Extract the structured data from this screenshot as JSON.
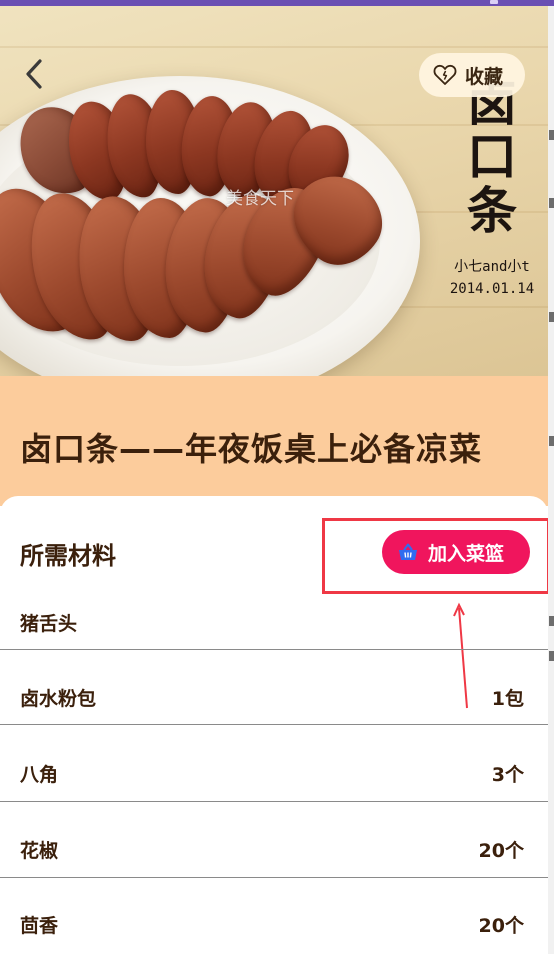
{
  "hero": {
    "callig_text": "卤口条",
    "credit_line1": "小七and小t",
    "credit_line2": "2014.01.14",
    "watermark": "美食天下"
  },
  "toolbar": {
    "back_icon": "chevron-left-icon",
    "favorite_icon": "heart-outline-icon",
    "favorite_label": "收藏"
  },
  "recipe": {
    "title": "卤口条——年夜饭桌上必备凉菜"
  },
  "ingredients": {
    "heading": "所需材料",
    "basket_icon": "basket-icon",
    "add_to_basket_label": "加入菜篮",
    "items": [
      {
        "name": "猪舌头",
        "amount": ""
      },
      {
        "name": "卤水粉包",
        "amount": "1包"
      },
      {
        "name": "八角",
        "amount": "3个"
      },
      {
        "name": "花椒",
        "amount": "20个"
      },
      {
        "name": "茴香",
        "amount": "20个"
      }
    ]
  },
  "colors": {
    "accent": "#f0155d",
    "title_band": "#fccc9c",
    "text": "#3b200c",
    "annotation": "#ef3845",
    "status_bar": "#6a4fb3"
  }
}
